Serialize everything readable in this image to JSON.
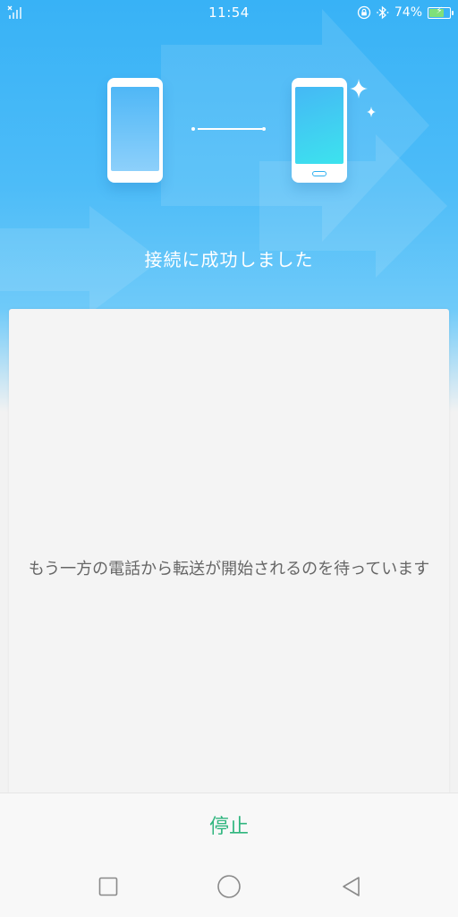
{
  "status_bar": {
    "time": "11:54",
    "battery_percent": "74%",
    "battery_level": 0.74,
    "icons": [
      "signal-icon",
      "lock-rotation-icon",
      "bluetooth-icon",
      "battery-icon"
    ]
  },
  "hero": {
    "title": "接続に成功しました",
    "icons": [
      "old-phone-icon",
      "new-phone-icon",
      "sparkle-icon"
    ]
  },
  "card": {
    "message": "もう一方の電話から転送が開始されるのを待っています"
  },
  "actions": {
    "stop_label": "停止"
  },
  "nav": {
    "icons": [
      "recent-apps-icon",
      "home-icon",
      "back-icon"
    ]
  },
  "colors": {
    "hero_blue": "#38b2f6",
    "accent_green": "#2fb57e",
    "message_gray": "#666666"
  }
}
